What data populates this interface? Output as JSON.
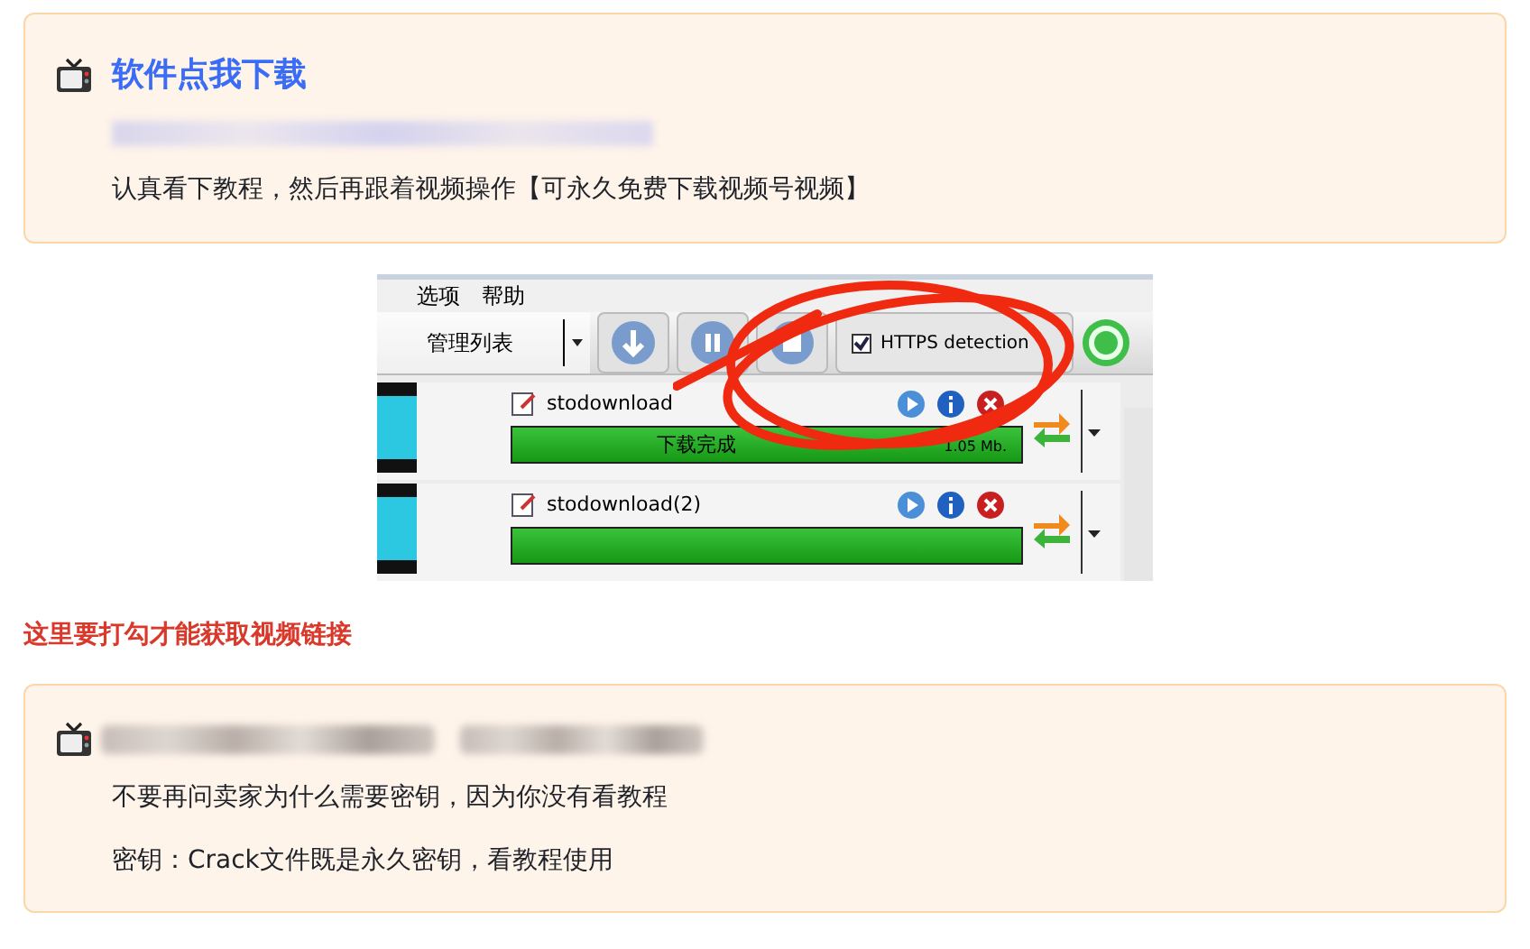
{
  "download_callout": {
    "title": "软件点我下载",
    "lines": [
      "认真看下教程，然后再跟着视频操作【可永久免费下载视频号视频】"
    ]
  },
  "screenshot": {
    "menu": [
      "选项",
      "帮助"
    ],
    "list_selector": "管理列表",
    "https_detection": {
      "label": "HTTPS detection",
      "checked": true
    },
    "downloads": [
      {
        "name": "stodownload",
        "status": "下载完成",
        "size": "1.05 Mb.",
        "level": 1
      },
      {
        "name": "stodownload(2)",
        "level": 1
      }
    ]
  },
  "note": "这里要打勾才能获取视频链接",
  "key_callout": {
    "lines": [
      "不要再问卖家为什么需要密钥，因为你没有看教程",
      "密钥：Crack文件既是永久密钥，看教程使用"
    ]
  }
}
